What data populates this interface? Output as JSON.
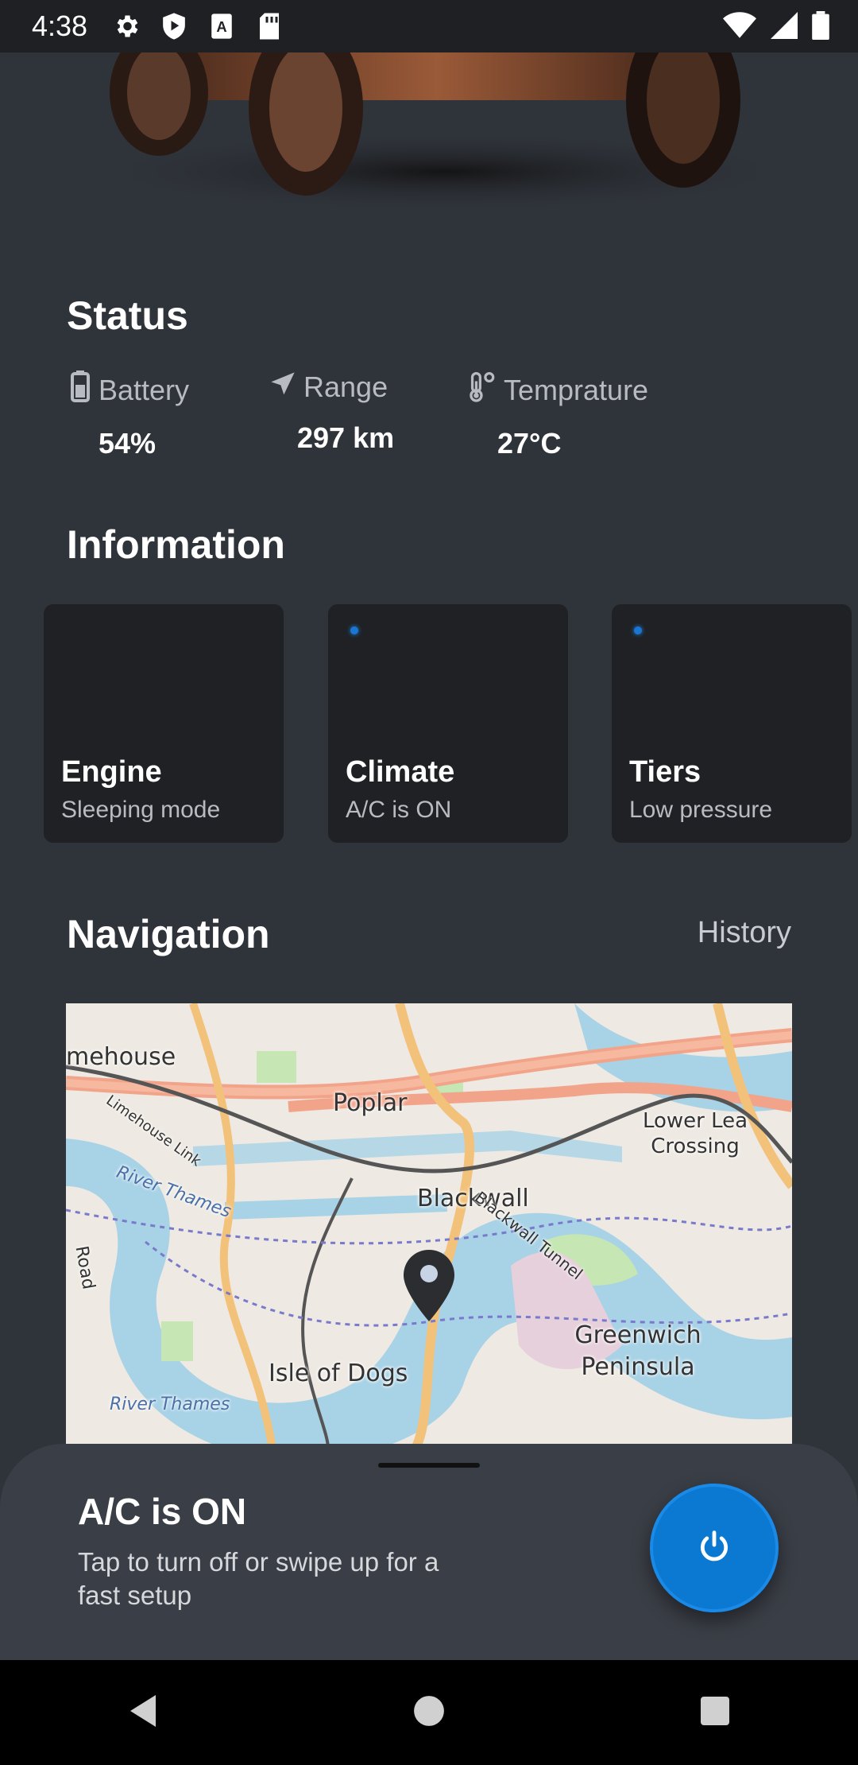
{
  "status_bar": {
    "time": "4:38"
  },
  "status": {
    "title": "Status",
    "items": [
      {
        "label": "Battery",
        "value": "54%",
        "icon": "battery-icon"
      },
      {
        "label": "Range",
        "value": "297 km",
        "icon": "navigation-arrow-icon"
      },
      {
        "label": "Temprature",
        "value": "27°C",
        "icon": "thermometer-icon"
      }
    ]
  },
  "information": {
    "title": "Information",
    "cards": [
      {
        "title": "Engine",
        "subtitle": "Sleeping mode"
      },
      {
        "title": "Climate",
        "subtitle": "A/C is ON"
      },
      {
        "title": "Tiers",
        "subtitle": "Low pressure"
      }
    ]
  },
  "navigation": {
    "title": "Navigation",
    "history_label": "History",
    "map_labels": [
      "mehouse",
      "Poplar",
      "Lower Lea Crossing",
      "Blackwall",
      "Blackwall Tunnel",
      "River Thames",
      "Greenwich Peninsula",
      "Isle of Dogs",
      "River Thames",
      "Road",
      "Limehouse Link"
    ]
  },
  "sheet": {
    "title": "A/C is ON",
    "subtitle": "Tap to turn off or swipe up for a fast setup"
  },
  "colors": {
    "accent": "#0b78d1",
    "background": "#2f333a",
    "card": "#1f2125"
  }
}
